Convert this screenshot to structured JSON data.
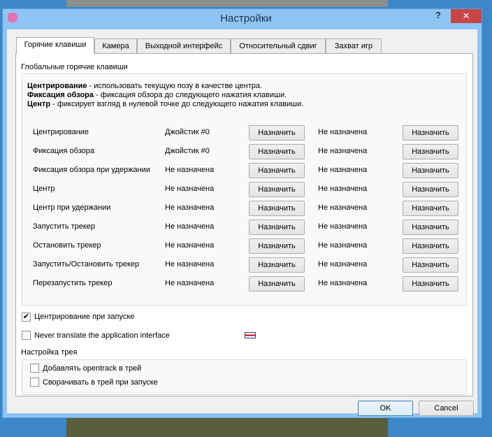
{
  "window": {
    "title": "Настройки",
    "help": "?",
    "close": "✕"
  },
  "tabs": [
    {
      "label": "Горячие клавиши"
    },
    {
      "label": "Камера"
    },
    {
      "label": "Выходной интерфейс"
    },
    {
      "label": "Относительный сдвиг"
    },
    {
      "label": "Захват игр"
    }
  ],
  "global_hotkeys": {
    "title": "Глобальные горячие клавиши",
    "help": [
      {
        "term": "Центрирование",
        "desc": " - использовать текущую позу в качестве центра."
      },
      {
        "term": "Фиксация обзора",
        "desc": " - фиксация обзора до следующего нажатия клавиши."
      },
      {
        "term": "Центр",
        "desc": " - фиксирует взгляд в нулевой точке до следующего нажатия клавиши."
      }
    ],
    "rows": [
      {
        "action": "Центрирование",
        "key1": "Джойстик #0",
        "key2": "Не назначена"
      },
      {
        "action": "Фиксация обзора",
        "key1": "Джойстик #0",
        "key2": "Не назначена"
      },
      {
        "action": "Фиксация обзора при удержании",
        "key1": "Не назначена",
        "key2": "Не назначена"
      },
      {
        "action": "Центр",
        "key1": "Не назначена",
        "key2": "Не назначена"
      },
      {
        "action": "Центр при удержании",
        "key1": "Не назначена",
        "key2": "Не назначена"
      },
      {
        "action": "Запустить трекер",
        "key1": "Не назначена",
        "key2": "Не назначена"
      },
      {
        "action": "Остановить трекер",
        "key1": "Не назначена",
        "key2": "Не назначена"
      },
      {
        "action": "Запустить/Остановить трекер",
        "key1": "Не назначена",
        "key2": "Не назначена"
      },
      {
        "action": "Перезапустить трекер",
        "key1": "Не назначена",
        "key2": "Не назначена"
      }
    ],
    "assign_label": "Назначить"
  },
  "options": {
    "center_on_start": {
      "label": "Центрирование при запуске",
      "checked": true,
      "mark": "✔"
    },
    "never_translate": {
      "label": "Never translate the application interface",
      "checked": false
    }
  },
  "tray": {
    "title": "Настройка трея",
    "add": {
      "label": "Добавлять opentrack в трей",
      "checked": false
    },
    "minimize": {
      "label": "Сворачивать в трей при запуске",
      "checked": false
    }
  },
  "footer": {
    "ok": "OK",
    "cancel": "Cancel"
  }
}
